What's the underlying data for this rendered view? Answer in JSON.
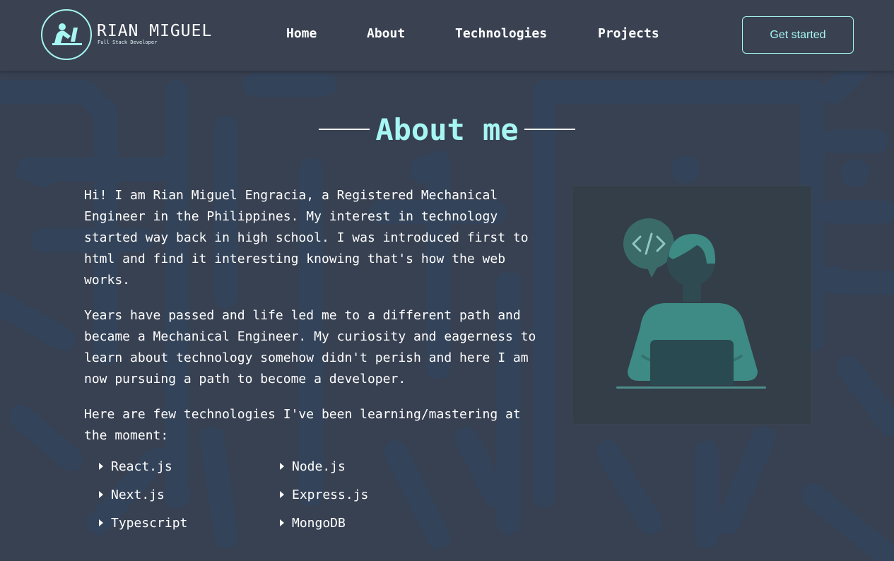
{
  "header": {
    "logo_name": "RIAN MIGUEL",
    "logo_subtitle": "Full Stack Developer",
    "logo_icon": "person-at-desk-icon",
    "nav": [
      {
        "label": "Home"
      },
      {
        "label": "About"
      },
      {
        "label": "Technologies"
      },
      {
        "label": "Projects"
      }
    ],
    "cta_label": "Get started"
  },
  "about": {
    "title": "About me",
    "paragraphs": [
      "Hi! I am Rian Miguel Engracia, a Registered Mechanical Engineer in the Philippines. My interest in technology started way back in high school. I was introduced first to html and find it interesting knowing that's how the web works.",
      "Years have passed and life led me to a different path and became a Mechanical Engineer. My curiosity and eagerness to learn about technology somehow didn't perish and here I am now pursuing a path to become a developer.",
      "Here are few technologies I've been learning/mastering at the moment:"
    ],
    "technologies": [
      "React.js",
      "Node.js",
      "Next.js",
      "Express.js",
      "Typescript",
      "MongoDB"
    ],
    "illustration_icon": "developer-with-laptop-illustration"
  },
  "colors": {
    "background": "#384152",
    "accent": "#a6f6f3",
    "illustration_teal": "#3e8a85"
  }
}
